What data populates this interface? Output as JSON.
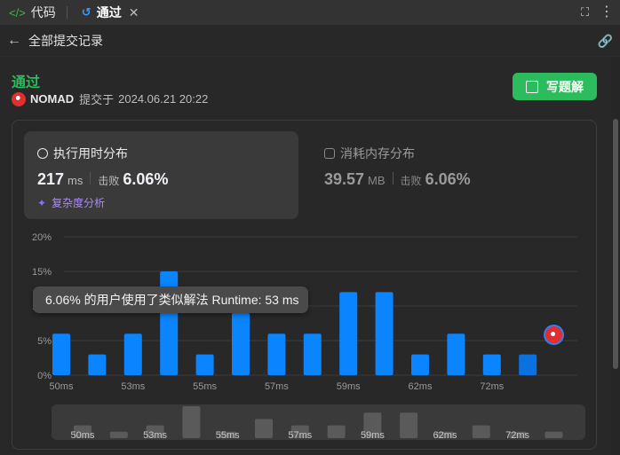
{
  "tabs": [
    {
      "label": "代码",
      "icon": "code-icon",
      "active": false
    },
    {
      "label": "通过",
      "icon": "history-icon",
      "active": true
    }
  ],
  "nav": {
    "back_icon": "arrow-left-icon",
    "title": "全部提交记录",
    "link_icon": "link-icon"
  },
  "submission": {
    "status": "通过",
    "user": "NOMAD",
    "submitted_prefix": "提交于",
    "submitted_at": "2024.06.21 20:22",
    "solution_button": "写题解"
  },
  "runtime": {
    "label": "执行用时分布",
    "value": "217",
    "unit": "ms",
    "beat_label": "击败",
    "beat": "6.06%",
    "analysis": "复杂度分析"
  },
  "memory": {
    "label": "消耗内存分布",
    "value": "39.57",
    "unit": "MB",
    "beat_label": "击败",
    "beat": "6.06%"
  },
  "tooltip": {
    "text": "6.06% 的用户使用了类似解法 Runtime: 53 ms"
  },
  "colors": {
    "accent": "#2cbb5d",
    "bar": "#0a84ff",
    "bar_dim": "#5a5a5a"
  },
  "chart_data": {
    "type": "bar",
    "y_ticks": [
      "20%",
      "15%",
      "10%",
      "5%",
      "0%"
    ],
    "ylim": [
      0,
      20
    ],
    "x_tick_labels": [
      "50ms",
      "53ms",
      "55ms",
      "57ms",
      "59ms",
      "62ms",
      "72ms"
    ],
    "x_tick_positions": [
      0,
      2,
      4,
      6,
      8,
      10,
      12
    ],
    "values": [
      6,
      3,
      6,
      15,
      3,
      9,
      6,
      6,
      12,
      12,
      3,
      6,
      3,
      3
    ],
    "highlighted_index": 13,
    "grid": true
  }
}
